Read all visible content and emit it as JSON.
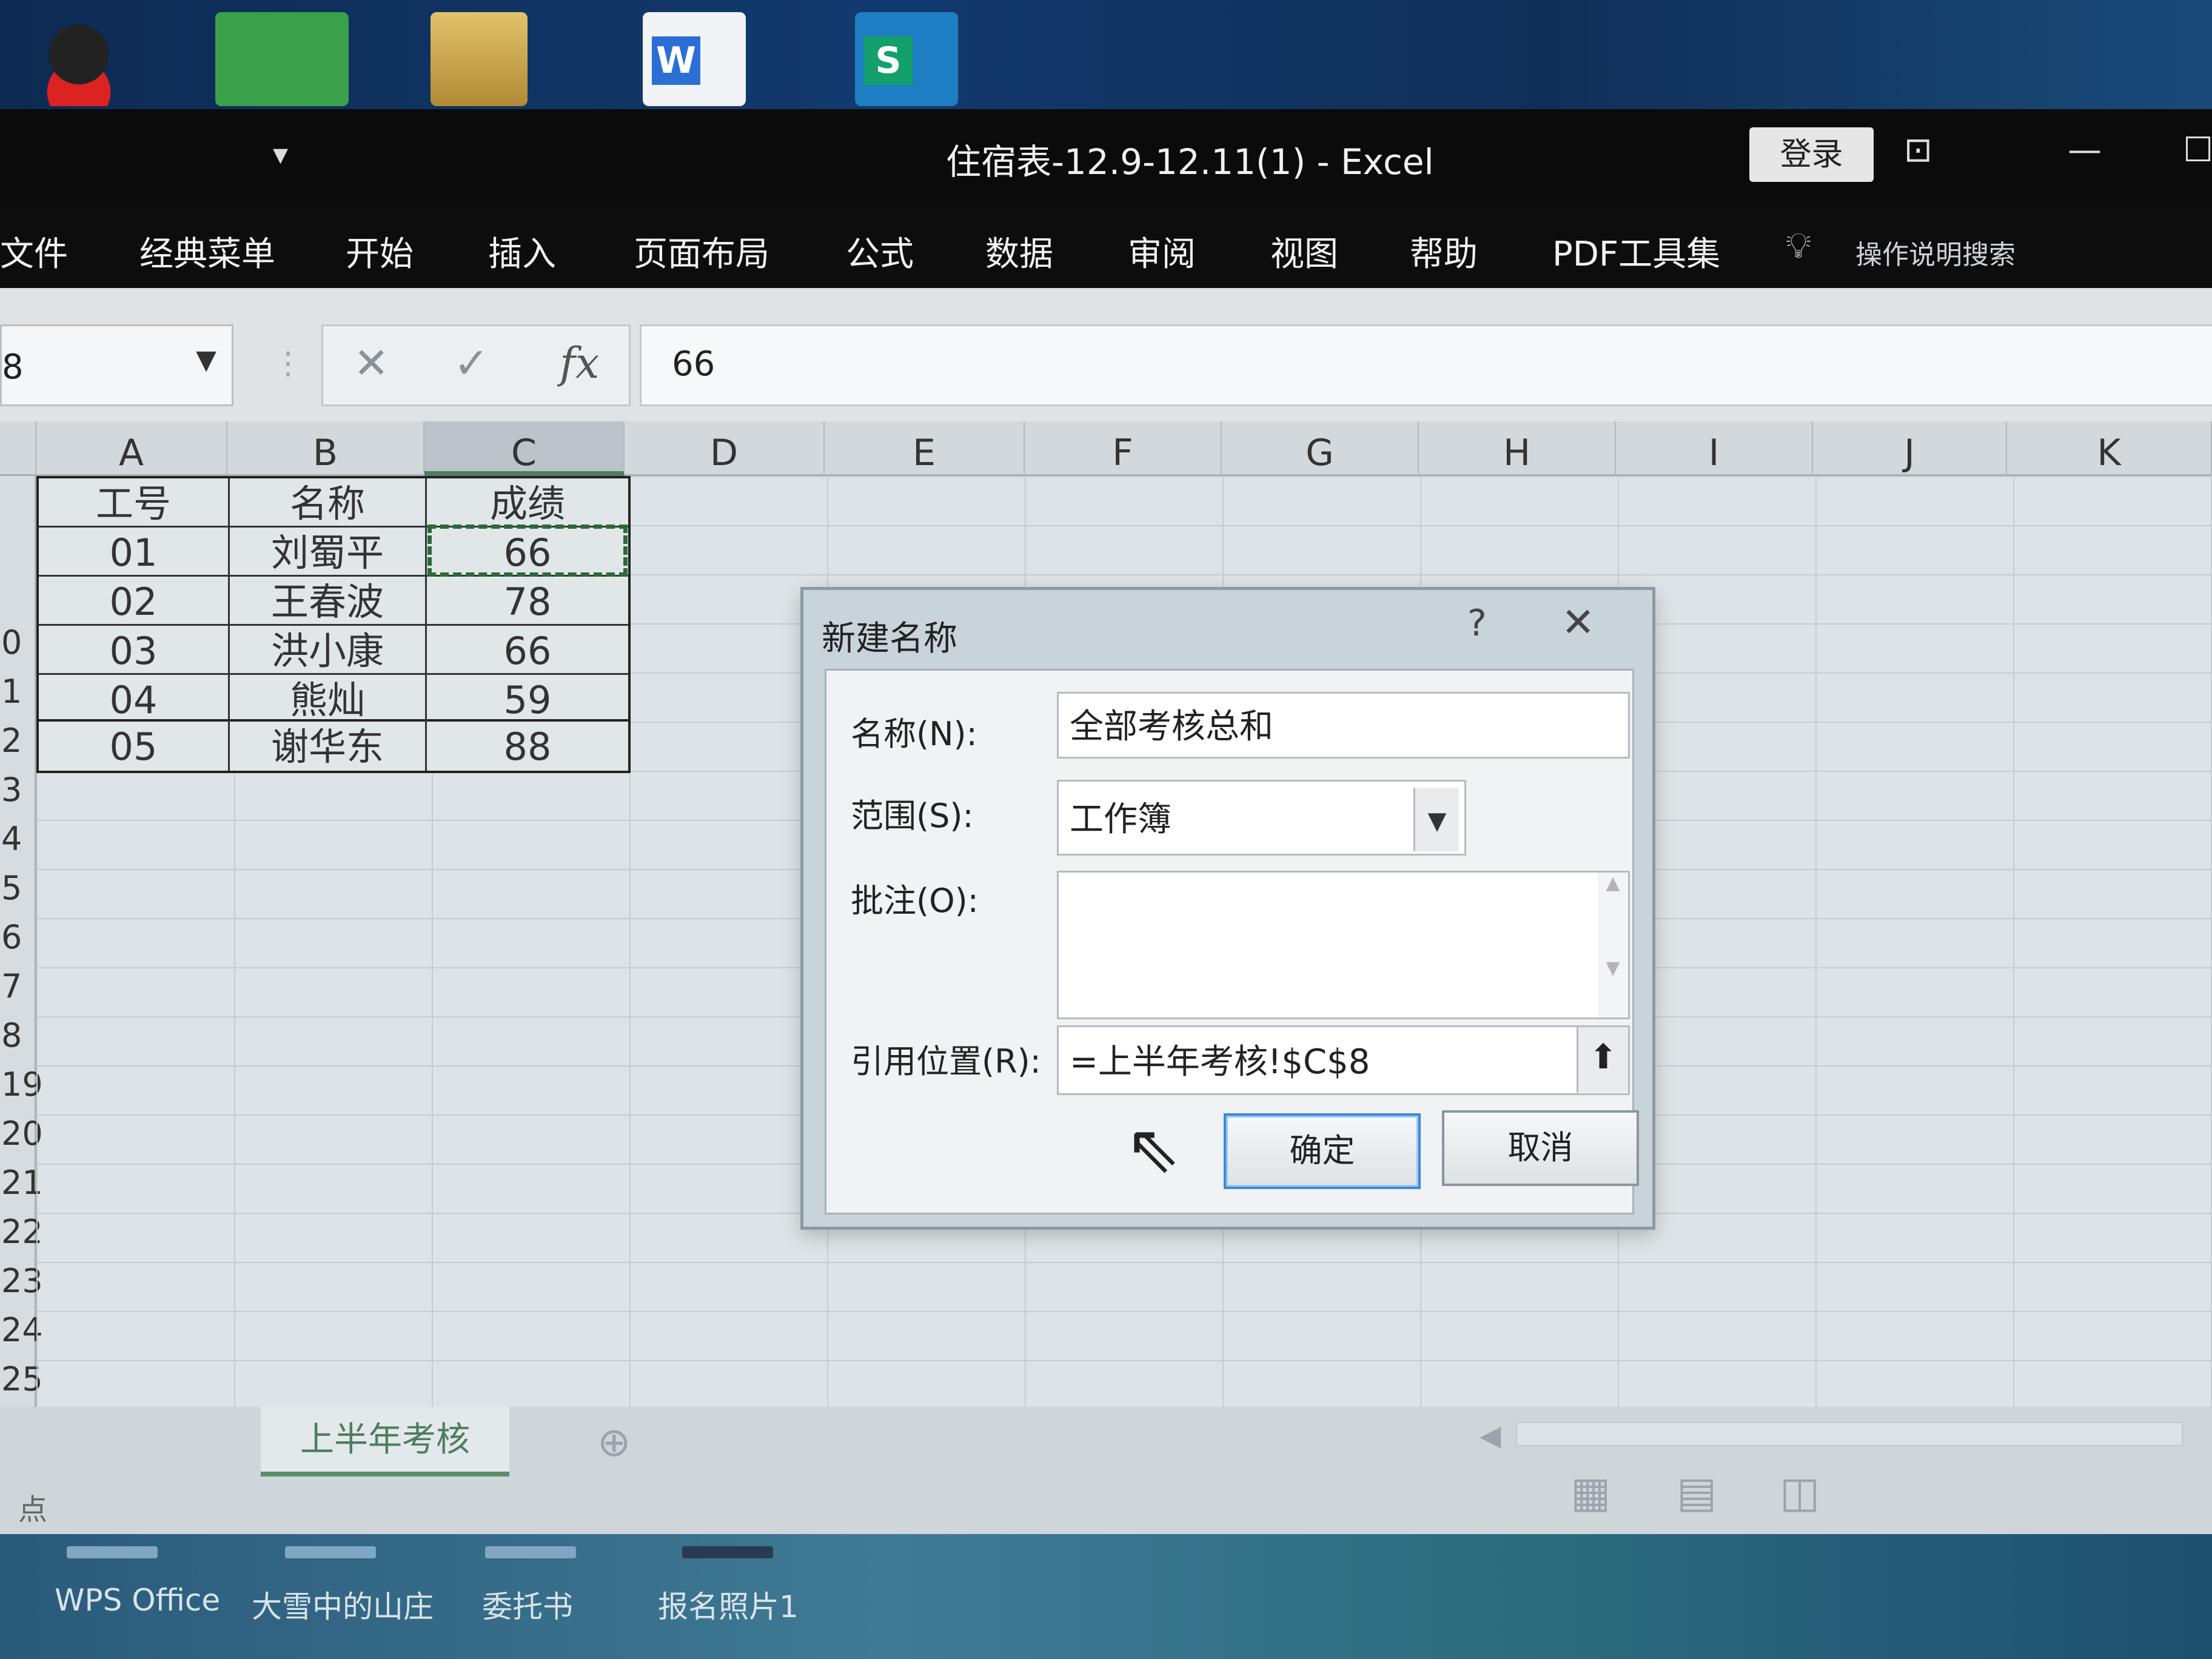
{
  "window": {
    "title": "住宿表-12.9-12.11(1)  -  Excel",
    "login": "登录"
  },
  "ribbon_tabs": [
    "文件",
    "经典菜单",
    "开始",
    "插入",
    "页面布局",
    "公式",
    "数据",
    "审阅",
    "视图",
    "帮助",
    "PDF工具集"
  ],
  "help_search": "操作说明搜索",
  "name_box": "8",
  "formula_value": "66",
  "columns": [
    "A",
    "B",
    "C",
    "D",
    "E",
    "F",
    "G",
    "H",
    "I",
    "J",
    "K"
  ],
  "rows": [
    "",
    "",
    "",
    "0",
    "1",
    "2",
    "3",
    "4",
    "5",
    "6",
    "7",
    "8",
    "19",
    "20",
    "21",
    "22",
    "23",
    "24",
    "25"
  ],
  "table": {
    "headers": [
      "工号",
      "名称",
      "成绩"
    ],
    "rows": [
      [
        "01",
        "刘蜀平",
        "66"
      ],
      [
        "02",
        "王春波",
        "78"
      ],
      [
        "03",
        "洪小康",
        "66"
      ],
      [
        "04",
        "熊灿",
        "59"
      ],
      [
        "05",
        "谢华东",
        "88"
      ]
    ]
  },
  "dialog": {
    "title": "新建名称",
    "help": "?",
    "close": "✕",
    "name_label": "名称(N):",
    "name_value": "全部考核总和",
    "scope_label": "范围(S):",
    "scope_value": "工作簿",
    "comment_label": "批注(O):",
    "comment_value": "",
    "refers_label": "引用位置(R):",
    "refers_value": "=上半年考核!$C$8",
    "ok": "确定",
    "cancel": "取消"
  },
  "sheet_tab": "上半年考核",
  "status_left": "点",
  "taskbar": [
    "WPS Office",
    "大雪中的山庄",
    "委托书",
    "报名照片1"
  ],
  "colors": {
    "accent_green": "#2a6a3a",
    "ok_border": "#3b8ad9"
  }
}
